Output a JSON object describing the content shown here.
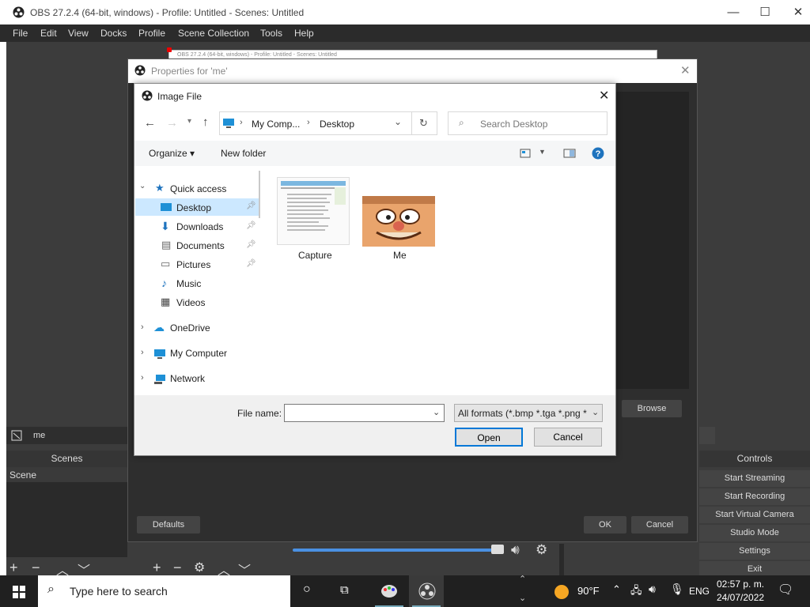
{
  "window": {
    "title": "OBS 27.2.4 (64-bit, windows) - Profile: Untitled - Scenes: Untitled",
    "min": "—",
    "max": "☐",
    "close": "✕"
  },
  "menu": [
    "File",
    "Edit",
    "View",
    "Docks",
    "Profile",
    "Scene Collection",
    "Tools",
    "Help"
  ],
  "preview_window_title": "OBS 27.2.4 (64-bit, windows) - Profile: Untitled - Scenes: Untitled",
  "source_name": "me",
  "scenes": {
    "header": "Scenes",
    "items": [
      "Scene"
    ]
  },
  "controls": {
    "header": "Controls",
    "buttons": [
      "Start Streaming",
      "Start Recording",
      "Start Virtual Camera",
      "Studio Mode",
      "Settings",
      "Exit"
    ]
  },
  "properties": {
    "title": "Properties for 'me'",
    "browse": "Browse",
    "defaults": "Defaults",
    "ok": "OK",
    "cancel": "Cancel"
  },
  "file_dialog": {
    "title": "Image File",
    "path": [
      "My Comp...",
      "Desktop"
    ],
    "search_placeholder": "Search Desktop",
    "organize": "Organize ▾",
    "new_folder": "New folder",
    "nav": {
      "quick_access": "Quick access",
      "items": [
        "Desktop",
        "Downloads",
        "Documents",
        "Pictures",
        "Music",
        "Videos"
      ],
      "onedrive": "OneDrive",
      "my_computer": "My Computer",
      "network": "Network"
    },
    "files": [
      "Capture",
      "Me"
    ],
    "filename_label": "File name:",
    "filename_value": "",
    "filter": "All formats (*.bmp *.tga *.png *",
    "open": "Open",
    "cancel": "Cancel"
  },
  "taskbar": {
    "search_placeholder": "Type here to search",
    "weather": "90°F",
    "lang": "ENG",
    "time": "02:57 p. m.",
    "date": "24/07/2022"
  }
}
